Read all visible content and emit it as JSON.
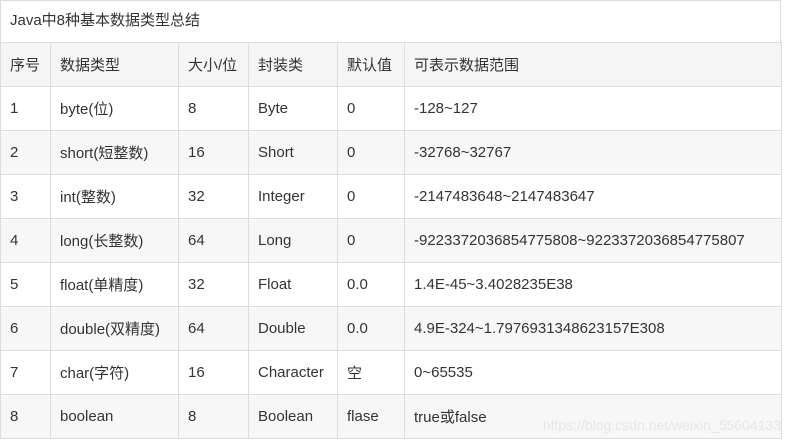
{
  "caption": "Java中8种基本数据类型总结",
  "headers": [
    "序号",
    "数据类型",
    "大小/位",
    "封装类",
    "默认值",
    "可表示数据范围"
  ],
  "rows": [
    [
      "1",
      "byte(位)",
      "8",
      "Byte",
      "0",
      "-128~127"
    ],
    [
      "2",
      "short(短整数)",
      "16",
      "Short",
      "0",
      "-32768~32767"
    ],
    [
      "3",
      "int(整数)",
      "32",
      "Integer",
      "0",
      "-2147483648~2147483647"
    ],
    [
      "4",
      "long(长整数)",
      "64",
      "Long",
      "0",
      "-9223372036854775808~9223372036854775807"
    ],
    [
      "5",
      "float(单精度)",
      "32",
      "Float",
      "0.0",
      "1.4E-45~3.4028235E38"
    ],
    [
      "6",
      "double(双精度)",
      "64",
      "Double",
      "0.0",
      "4.9E-324~1.7976931348623157E308"
    ],
    [
      "7",
      "char(字符)",
      "16",
      "Character",
      "空",
      "0~65535"
    ],
    [
      "8",
      "boolean",
      "8",
      "Boolean",
      "flase",
      "true或false"
    ]
  ],
  "watermark": "https://blog.csdn.net/weixin_55604133"
}
